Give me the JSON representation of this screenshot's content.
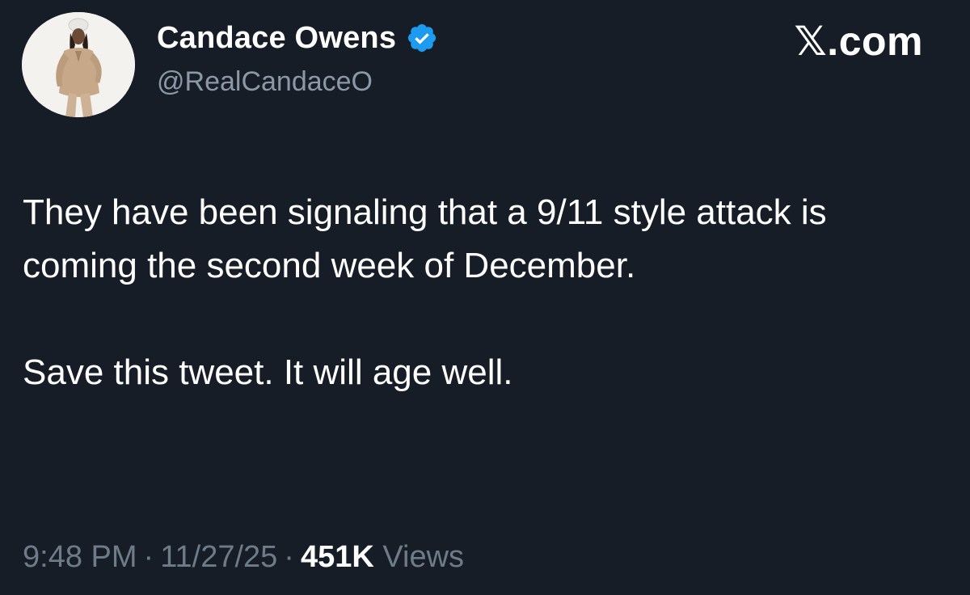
{
  "author": {
    "display_name": "Candace Owens",
    "handle": "@RealCandaceO",
    "avatar_icon": "profile-photo",
    "verified_icon": "verified-badge-icon",
    "verified_color": "#1d9bf0"
  },
  "brand": {
    "label": "𝕏.com"
  },
  "tweet": {
    "paragraphs": [
      "They have been signaling that a 9/11 style attack is coming the second week of December.",
      "Save this tweet. It will age well."
    ]
  },
  "meta": {
    "time": "9:48 PM",
    "separator": "·",
    "date": "11/27/25",
    "views_count": "451K",
    "views_label": "Views"
  },
  "colors": {
    "background": "#171d27",
    "primary_text": "#ffffff",
    "secondary_text": "#8b98a5",
    "meta_text": "#6e7b88"
  }
}
